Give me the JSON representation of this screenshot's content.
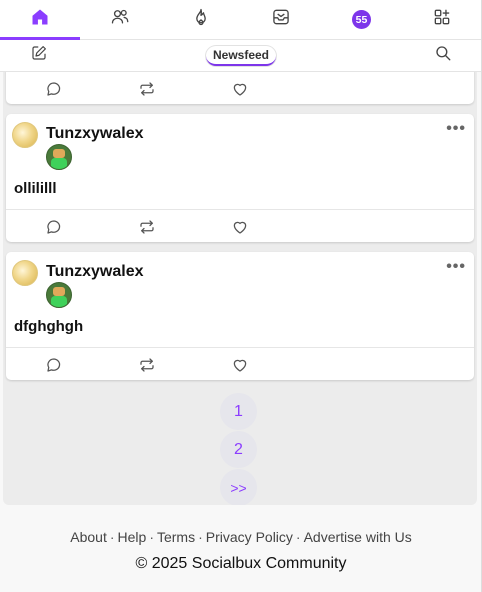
{
  "nav": {
    "badge_count": "55",
    "accent_color": "#8b3dff",
    "tabs": [
      {
        "icon": "home-icon",
        "active": true
      },
      {
        "icon": "friends-icon",
        "active": false
      },
      {
        "icon": "trending-fire-icon",
        "active": false
      },
      {
        "icon": "messages-icon",
        "active": false
      },
      {
        "icon": "notifications-badge",
        "active": false
      },
      {
        "icon": "apps-grid-icon",
        "active": false
      }
    ]
  },
  "subbar": {
    "compose_icon": "compose-icon",
    "title": "Newsfeed",
    "search_icon": "search-icon"
  },
  "posts": [
    {
      "author": "Tunzxywalex",
      "content": "ollililll"
    },
    {
      "author": "Tunzxywalex",
      "content": "dfghghgh"
    }
  ],
  "post_actions": [
    "comment-icon",
    "repost-icon",
    "like-icon"
  ],
  "pagination": [
    "1",
    "2",
    ">>"
  ],
  "footer": {
    "links": [
      "About",
      "Help",
      "Terms",
      "Privacy Policy",
      "Advertise with Us"
    ],
    "separator": "·",
    "copyright": "© 2025 Socialbux Community"
  }
}
